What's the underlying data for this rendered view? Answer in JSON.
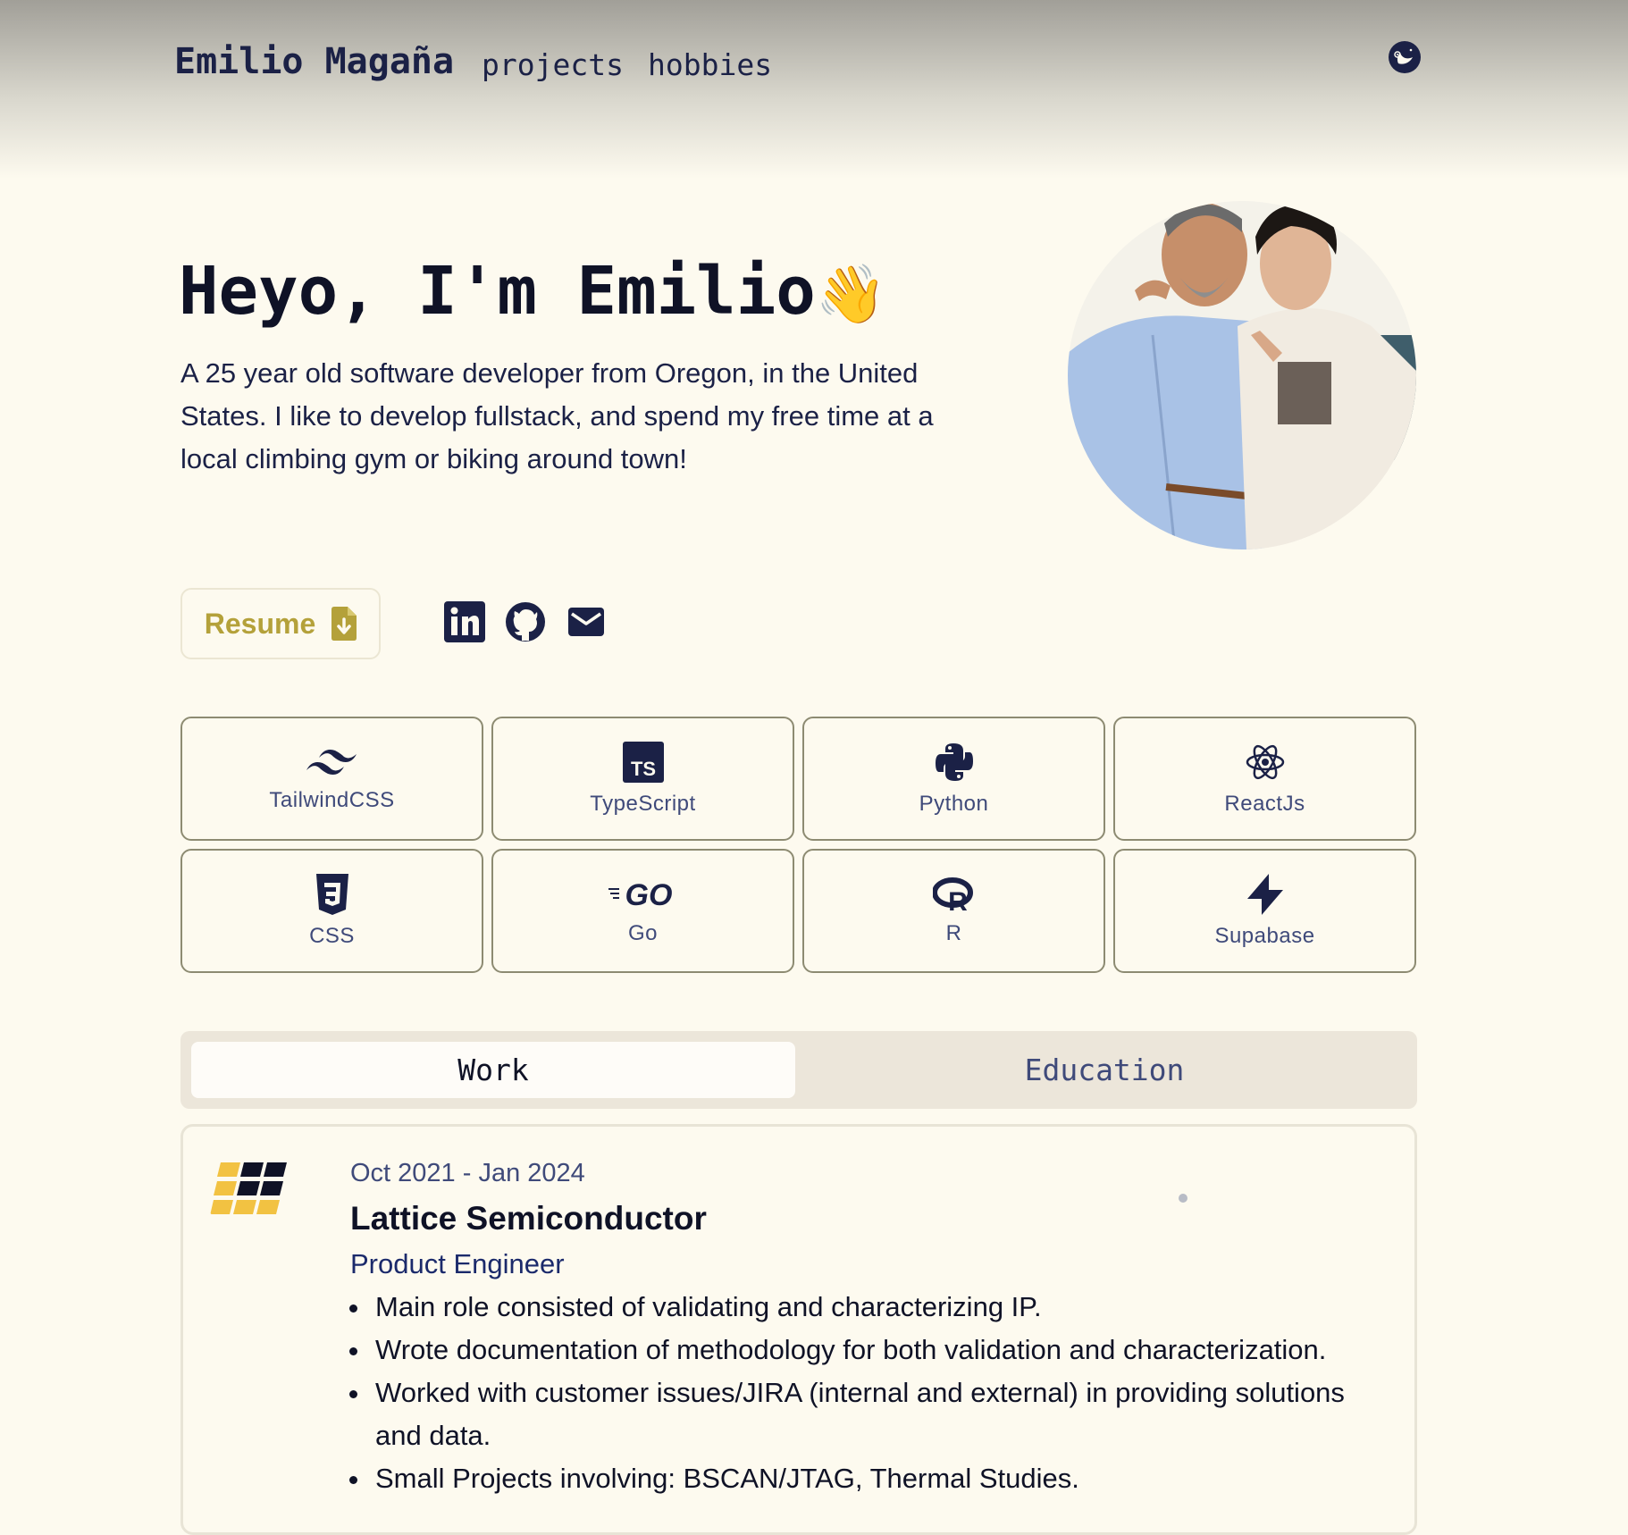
{
  "nav": {
    "brand": "Emilio Magaña",
    "links": [
      "projects",
      "hobbies"
    ]
  },
  "hero": {
    "title": "Heyo, I'm Emilio",
    "wave_emoji": "👋",
    "description": "A 25 year old software developer from Oregon, in the United States. I like to develop fullstack, and spend my free time at a local climbing gym or biking around town!"
  },
  "resume": {
    "label": "Resume"
  },
  "social": [
    "linkedin-icon",
    "github-icon",
    "mail-icon"
  ],
  "skills": [
    {
      "label": "TailwindCSS",
      "icon": "tailwind-icon"
    },
    {
      "label": "TypeScript",
      "icon": "typescript-icon"
    },
    {
      "label": "Python",
      "icon": "python-icon"
    },
    {
      "label": "ReactJs",
      "icon": "react-icon"
    },
    {
      "label": "CSS",
      "icon": "css-icon"
    },
    {
      "label": "Go",
      "icon": "go-icon"
    },
    {
      "label": "R",
      "icon": "r-icon"
    },
    {
      "label": "Supabase",
      "icon": "supabase-icon"
    }
  ],
  "tabs": {
    "work": "Work",
    "education": "Education"
  },
  "job": {
    "dates": "Oct 2021 - Jan 2024",
    "company": "Lattice Semiconductor",
    "role": "Product Engineer",
    "bullets": [
      "Main role consisted of validating and characterizing IP.",
      "Wrote documentation of methodology for both validation and characterization.",
      "Worked with customer issues/JIRA (internal and external) in providing solutions and data.",
      "Small Projects involving: BSCAN/JTAG, Thermal Studies."
    ]
  },
  "colors": {
    "background": "#fdfaef",
    "navy": "#1b2146",
    "accent_gold": "#b4a13a",
    "card_border": "#8d8b72"
  }
}
